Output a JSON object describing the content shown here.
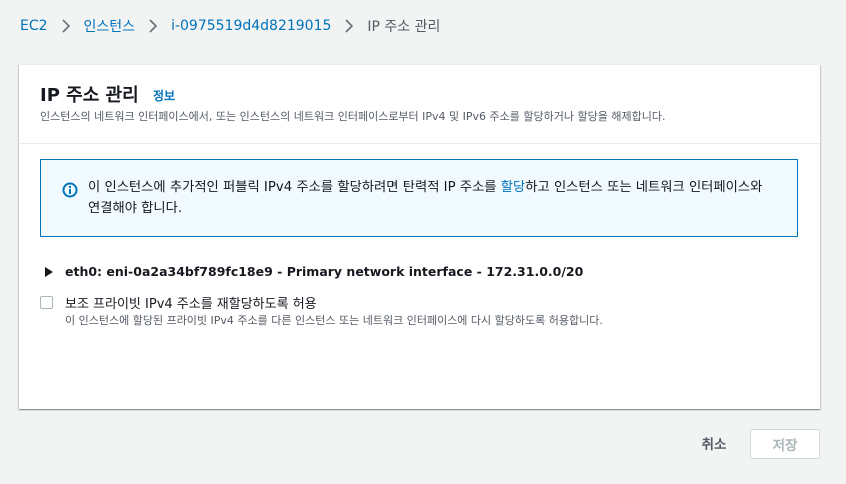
{
  "breadcrumb": {
    "items": [
      "EC2",
      "인스턴스",
      "i-0975519d4d8219015"
    ],
    "current": "IP 주소 관리"
  },
  "panel": {
    "title": "IP 주소 관리",
    "info_link": "정보",
    "description": "인스턴스의 네트워크 인터페이스에서, 또는 인스턴스의 네트워크 인터페이스로부터 IPv4 및 IPv6 주소를 할당하거나 할당을 해제합니다."
  },
  "alert": {
    "icon": "info-icon",
    "text_before": "이 인스턴스에 추가적인 퍼블릭 IPv4 주소를 할당하려면 탄력적 IP 주소를 ",
    "link": "할당",
    "text_after": "하고 인스턴스 또는 네트워크 인터페이스와 연결해야 합니다."
  },
  "interface": {
    "label": "eth0: eni-0a2a34bf789fc18e9 - Primary network interface - 172.31.0.0/20",
    "expanded": false
  },
  "reassign": {
    "label": "보조 프라이빗 IPv4 주소를 재할당하도록 허용",
    "description": "이 인스턴스에 할당된 프라이빗 IPv4 주소를 다른 인스턴스 또는 네트워크 인터페이스에 다시 할당하도록 허용합니다.",
    "checked": false
  },
  "footer": {
    "cancel_label": "취소",
    "save_label": "저장"
  },
  "colors": {
    "link": "#0073bb",
    "alert_bg": "#f1faff",
    "alert_border": "#0073bb"
  }
}
